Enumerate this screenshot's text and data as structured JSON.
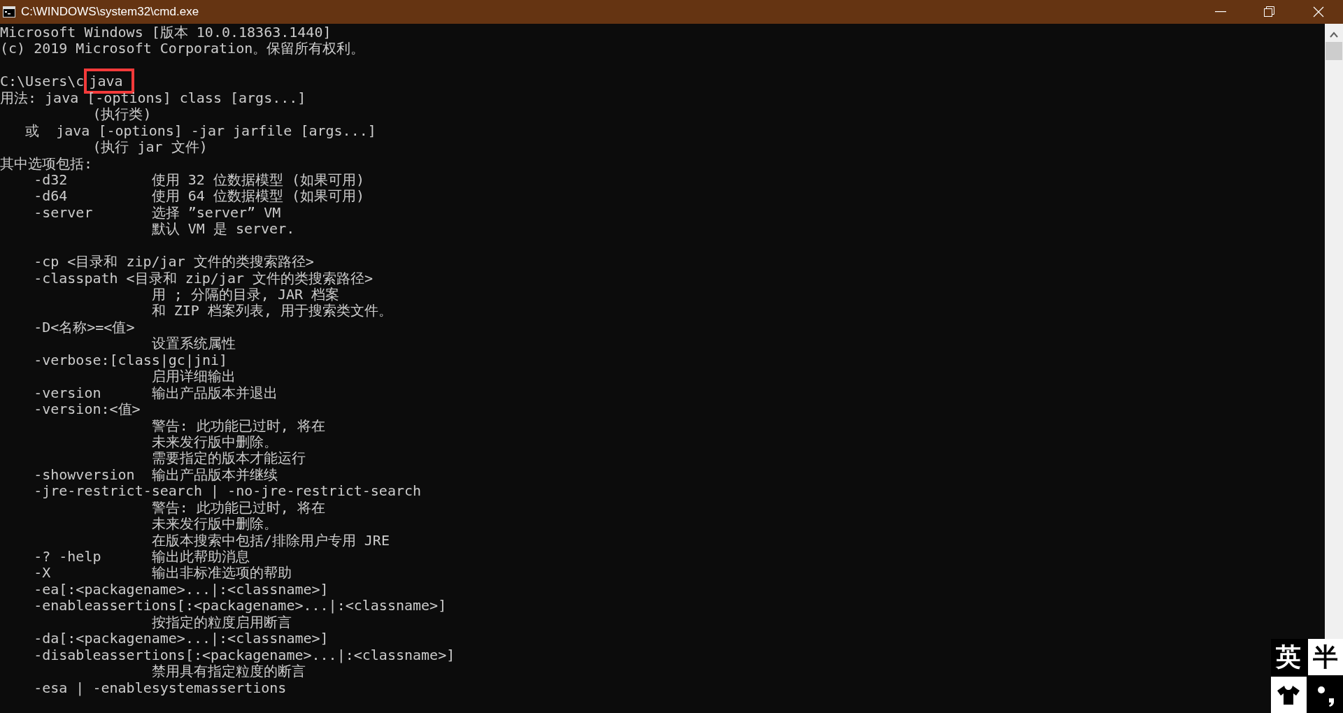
{
  "window": {
    "title": "C:\\WINDOWS\\system32\\cmd.exe"
  },
  "console": {
    "lines": [
      {
        "kind": "text",
        "text": "Microsoft Windows [版本 10.0.18363.1440]"
      },
      {
        "kind": "text",
        "text": "(c) 2019 Microsoft Corporation。保留所有权利。"
      },
      {
        "kind": "blank"
      },
      {
        "kind": "prompt",
        "prompt": "C:\\Users\\c",
        "command": "java",
        "highlighted": true
      },
      {
        "kind": "text",
        "text": "用法: java [-options] class [args...]"
      },
      {
        "kind": "text",
        "text": "           (执行类)"
      },
      {
        "kind": "text",
        "text": "   或  java [-options] -jar jarfile [args...]"
      },
      {
        "kind": "text",
        "text": "           (执行 jar 文件)"
      },
      {
        "kind": "text",
        "text": "其中选项包括:"
      },
      {
        "kind": "text",
        "text": "    -d32          使用 32 位数据模型 (如果可用)"
      },
      {
        "kind": "text",
        "text": "    -d64          使用 64 位数据模型 (如果可用)"
      },
      {
        "kind": "text",
        "text": "    -server       选择 ”server” VM"
      },
      {
        "kind": "text",
        "text": "                  默认 VM 是 server."
      },
      {
        "kind": "blank"
      },
      {
        "kind": "text",
        "text": "    -cp <目录和 zip/jar 文件的类搜索路径>"
      },
      {
        "kind": "text",
        "text": "    -classpath <目录和 zip/jar 文件的类搜索路径>"
      },
      {
        "kind": "text",
        "text": "                  用 ; 分隔的目录, JAR 档案"
      },
      {
        "kind": "text",
        "text": "                  和 ZIP 档案列表, 用于搜索类文件。"
      },
      {
        "kind": "text",
        "text": "    -D<名称>=<值>"
      },
      {
        "kind": "text",
        "text": "                  设置系统属性"
      },
      {
        "kind": "text",
        "text": "    -verbose:[class|gc|jni]"
      },
      {
        "kind": "text",
        "text": "                  启用详细输出"
      },
      {
        "kind": "text",
        "text": "    -version      输出产品版本并退出"
      },
      {
        "kind": "text",
        "text": "    -version:<值>"
      },
      {
        "kind": "text",
        "text": "                  警告: 此功能已过时, 将在"
      },
      {
        "kind": "text",
        "text": "                  未来发行版中删除。"
      },
      {
        "kind": "text",
        "text": "                  需要指定的版本才能运行"
      },
      {
        "kind": "text",
        "text": "    -showversion  输出产品版本并继续"
      },
      {
        "kind": "text",
        "text": "    -jre-restrict-search | -no-jre-restrict-search"
      },
      {
        "kind": "text",
        "text": "                  警告: 此功能已过时, 将在"
      },
      {
        "kind": "text",
        "text": "                  未来发行版中删除。"
      },
      {
        "kind": "text",
        "text": "                  在版本搜索中包括/排除用户专用 JRE"
      },
      {
        "kind": "text",
        "text": "    -? -help      输出此帮助消息"
      },
      {
        "kind": "text",
        "text": "    -X            输出非标准选项的帮助"
      },
      {
        "kind": "text",
        "text": "    -ea[:<packagename>...|:<classname>]"
      },
      {
        "kind": "text",
        "text": "    -enableassertions[:<packagename>...|:<classname>]"
      },
      {
        "kind": "text",
        "text": "                  按指定的粒度启用断言"
      },
      {
        "kind": "text",
        "text": "    -da[:<packagename>...|:<classname>]"
      },
      {
        "kind": "text",
        "text": "    -disableassertions[:<packagename>...|:<classname>]"
      },
      {
        "kind": "text",
        "text": "                  禁用具有指定粒度的断言"
      },
      {
        "kind": "text",
        "text": "    -esa | -enablesystemassertions"
      }
    ]
  },
  "ime_bar": {
    "language": "英",
    "width_mode": "半"
  }
}
